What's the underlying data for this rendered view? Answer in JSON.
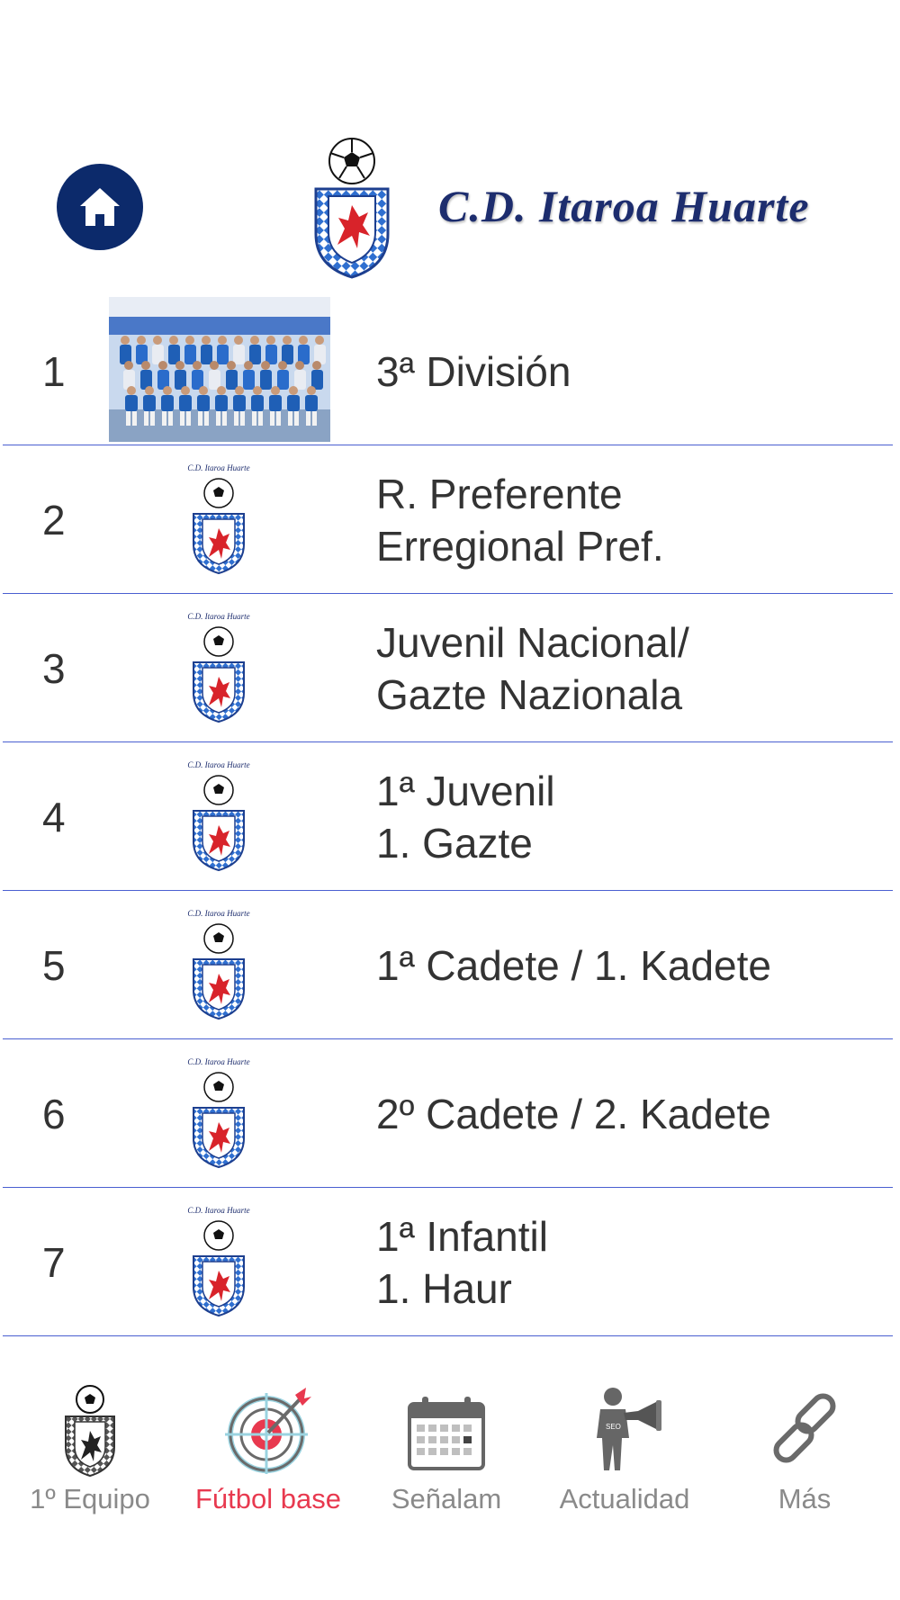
{
  "header": {
    "club_name": "C.D. Itaroa Huarte",
    "mini_caption": "C.D. Itaroa Huarte"
  },
  "teams": [
    {
      "number": "1",
      "lines": [
        "3ª División"
      ],
      "thumb": "team-photo"
    },
    {
      "number": "2",
      "lines": [
        "R. Preferente",
        "Erregional Pref."
      ],
      "thumb": "club-crest"
    },
    {
      "number": "3",
      "lines": [
        "Juvenil Nacional/",
        "Gazte Nazionala"
      ],
      "thumb": "club-crest"
    },
    {
      "number": "4",
      "lines": [
        "1ª Juvenil",
        "1. Gazte"
      ],
      "thumb": "club-crest"
    },
    {
      "number": "5",
      "lines": [
        "1ª Cadete / 1. Kadete"
      ],
      "thumb": "club-crest"
    },
    {
      "number": "6",
      "lines": [
        "2º Cadete / 2. Kadete"
      ],
      "thumb": "club-crest"
    },
    {
      "number": "7",
      "lines": [
        "1ª Infantil",
        "1. Haur"
      ],
      "thumb": "club-crest"
    }
  ],
  "tabs": [
    {
      "label": "1º Equipo",
      "icon": "crest-icon",
      "active": false
    },
    {
      "label": "Fútbol base",
      "icon": "target-icon",
      "active": true
    },
    {
      "label": "Señalam",
      "icon": "calendar-icon",
      "active": false
    },
    {
      "label": "Actualidad",
      "icon": "megaphone-icon",
      "active": false
    },
    {
      "label": "Más",
      "icon": "link-icon",
      "active": false
    }
  ],
  "colors": {
    "navy": "#0c2a6b",
    "club_text": "#1d2d6e",
    "separator": "#4a5fd1",
    "active_tab": "#e8394f",
    "inactive_tab": "#8a8a8a"
  }
}
